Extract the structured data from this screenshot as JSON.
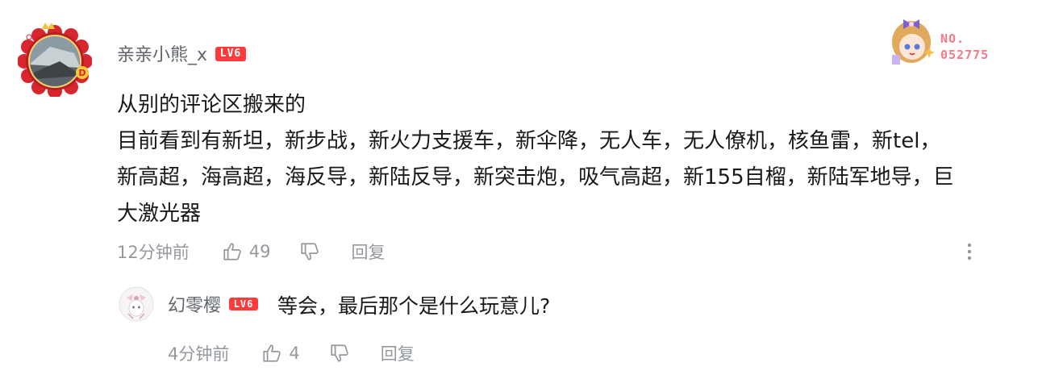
{
  "comment": {
    "username": "亲亲小熊_x",
    "level_badge": "LV6",
    "decoration": {
      "no_label": "NO.",
      "number": "052775"
    },
    "lines": [
      "从别的评论区搬来的",
      "目前看到有新坦，新步战，新火力支援车，新伞降，无人车，无人僚机，核鱼雷，新tel，",
      "新高超，海高超，海反导，新陆反导，新突击炮，吸气高超，新155自榴，新陆军地导，巨",
      "大激光器"
    ],
    "time": "12分钟前",
    "like_count": "49",
    "reply_label": "回复"
  },
  "reply": {
    "username": "幻零樱",
    "level_badge": "LV6",
    "text": "等会，最后那个是什么玩意儿?",
    "time": "4分钟前",
    "like_count": "4",
    "reply_label": "回复"
  },
  "colors": {
    "username": "#61666d",
    "meta": "#9499a0",
    "text": "#18191c",
    "badge": "#ff3b3b",
    "decor_text": "#f27a86"
  },
  "icons": [
    "avatar",
    "thumb-up-icon",
    "thumb-down-icon",
    "more-vertical-icon",
    "decoration-badge"
  ]
}
